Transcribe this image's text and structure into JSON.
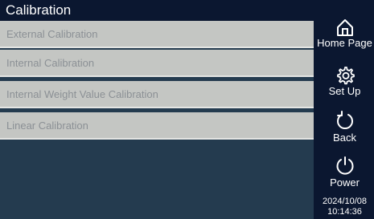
{
  "header": {
    "title": "Calibration"
  },
  "menu": {
    "items": [
      {
        "label": "External Calibration"
      },
      {
        "label": "Internal Calibration"
      },
      {
        "label": "Internal Weight Value Calibration"
      },
      {
        "label": "Linear Calibration"
      }
    ]
  },
  "sidebar": {
    "home": {
      "label": "Home Page",
      "icon": "home-icon"
    },
    "setup": {
      "label": "Set Up",
      "icon": "gear-icon"
    },
    "back": {
      "label": "Back",
      "icon": "back-arrow-icon"
    },
    "power": {
      "label": "Power",
      "icon": "power-icon"
    }
  },
  "status": {
    "date": "2024/10/08",
    "time": "10:14:36"
  },
  "colors": {
    "background": "#0b1730",
    "panel": "#243b4f",
    "menu_item": "#c4c6c3",
    "menu_text": "#8b9095"
  }
}
